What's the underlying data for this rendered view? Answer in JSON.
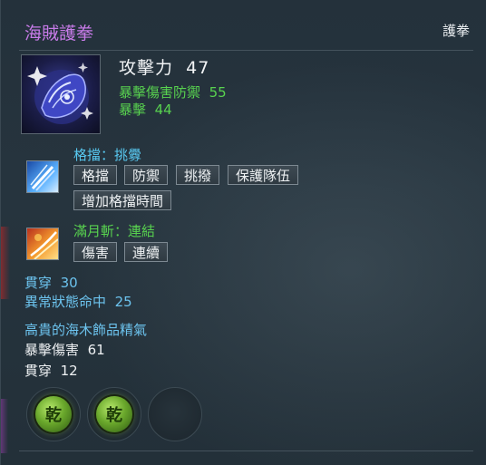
{
  "item": {
    "name": "海賊護拳",
    "type": "護拳",
    "name_color": "#c77be8"
  },
  "main_stat": {
    "label": "攻擊力",
    "value": "47"
  },
  "sub_stats": [
    {
      "label": "暴擊傷害防禦",
      "value": "55"
    },
    {
      "label": "暴擊",
      "value": "44"
    }
  ],
  "skill1": {
    "title": "格擋：挑釁",
    "icon": "sword-clash-icon",
    "tags": [
      "格擋",
      "防禦",
      "挑撥",
      "保護隊伍",
      "增加格擋時間"
    ]
  },
  "skill2": {
    "title": "滿月斬：連結",
    "icon": "slash-fire-icon",
    "tags": [
      "傷害",
      "連續"
    ]
  },
  "extra_stats": [
    {
      "label": "貫穿",
      "value": "30"
    },
    {
      "label": "異常狀態命中",
      "value": "25"
    }
  ],
  "soul": {
    "title": "高貴的海木飾品精氣",
    "stats": [
      {
        "label": "暴擊傷害",
        "value": "61"
      },
      {
        "label": "貫穿",
        "value": "12"
      }
    ]
  },
  "gems": [
    {
      "glyph": "乾",
      "icon": "gem-qian-icon"
    },
    {
      "glyph": "乾",
      "icon": "gem-qian-icon"
    },
    {
      "glyph": "",
      "icon": "empty-gem-slot"
    }
  ],
  "colors": {
    "green": "#58d24f",
    "blue": "#6cc3ee",
    "white": "#eef1f3"
  }
}
